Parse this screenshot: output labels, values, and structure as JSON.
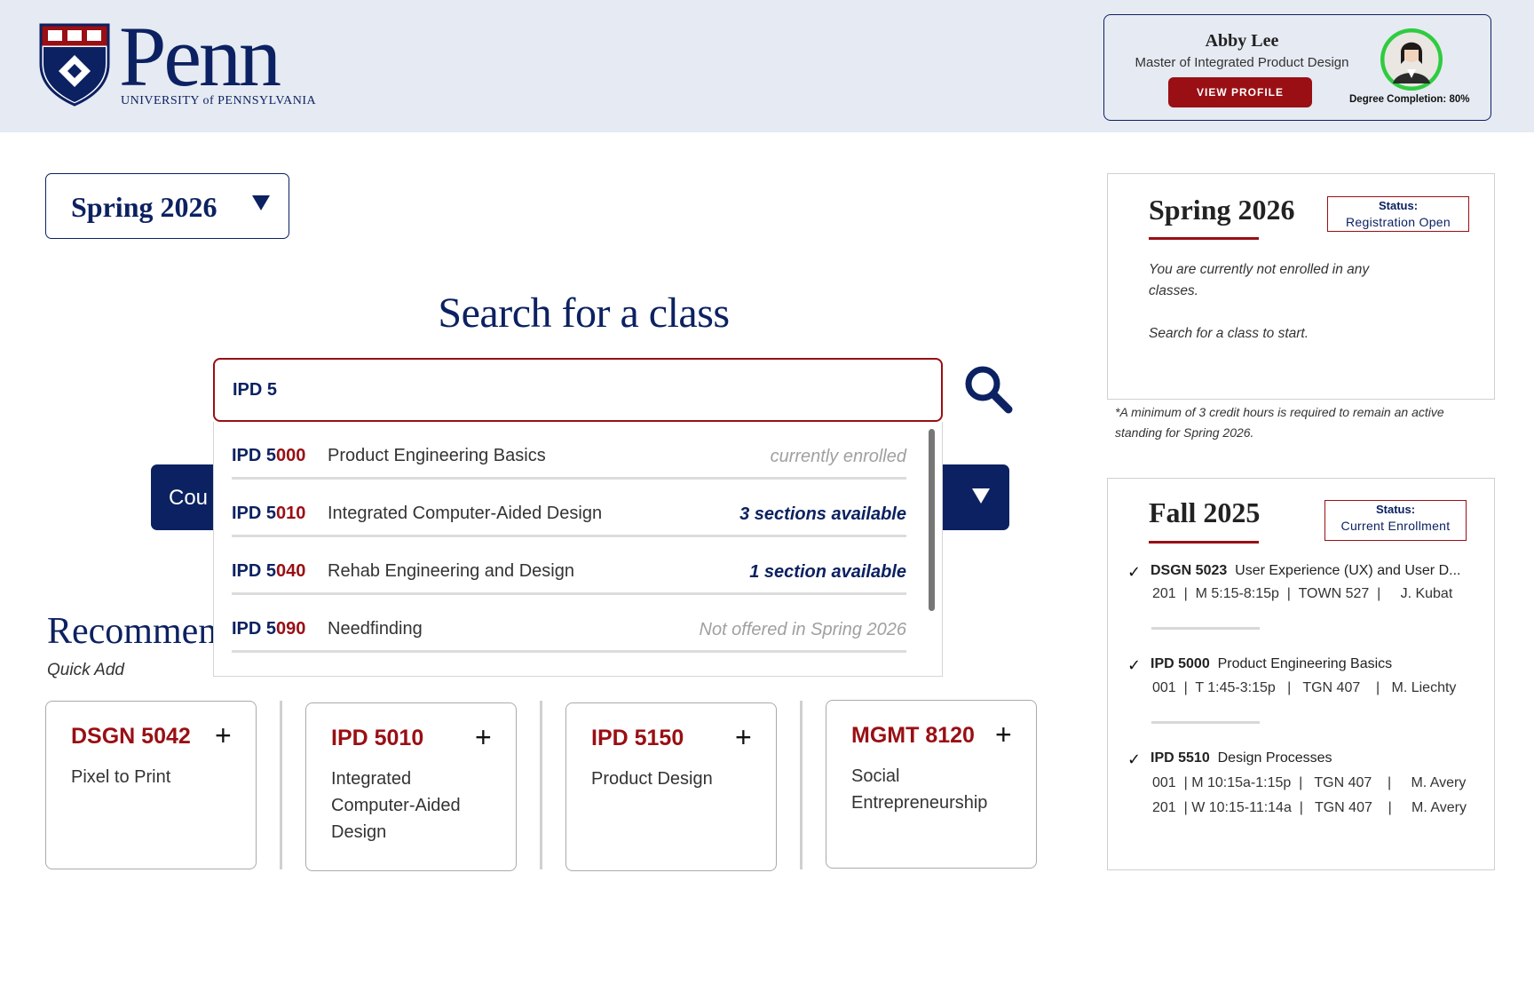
{
  "header": {
    "logo_wordmark": "Penn",
    "logo_subtitle": "UNIVERSITY of PENNSYLVANIA",
    "profile": {
      "name": "Abby Lee",
      "degree": "Master of Integrated Product Design",
      "button": "VIEW PROFILE",
      "completion_label": "Degree Completion: 80%",
      "completion": 0.8
    }
  },
  "term_select": {
    "value": "Spring 2026"
  },
  "search": {
    "title": "Search for a class",
    "query": "IPD 5",
    "results": [
      {
        "match": "IPD 5",
        "rest": "000",
        "name": "Product Engineering Basics",
        "status": "currently enrolled",
        "style": "grey"
      },
      {
        "match": "IPD 5",
        "rest": "010",
        "name": "Integrated Computer-Aided Design",
        "status": "3 sections available",
        "style": "blue"
      },
      {
        "match": "IPD 5",
        "rest": "040",
        "name": "Rehab Engineering and Design",
        "status": "1 section available",
        "style": "blue"
      },
      {
        "match": "IPD 5",
        "rest": "090",
        "name": "Needfinding",
        "status": "Not offered in Spring 2026",
        "style": "grey"
      }
    ]
  },
  "course_bar": {
    "label": "Cou"
  },
  "recommended": {
    "title": "Recommen",
    "subtitle": "Quick Add",
    "cards": [
      {
        "code": "DSGN 5042",
        "name": "Pixel to Print"
      },
      {
        "code": "IPD 5010",
        "name": "Integrated Computer-Aided Design"
      },
      {
        "code": "IPD 5150",
        "name": "Product Design"
      },
      {
        "code": "MGMT 8120",
        "name": "Social Entrepreneurship"
      }
    ],
    "plus": "+"
  },
  "spring_panel": {
    "title": "Spring 2026",
    "status_label": "Status:",
    "status_value": "Registration Open",
    "msg1": "You are currently not enrolled in any classes.",
    "msg2": "Search for a class to start."
  },
  "credit_note": "*A minimum of 3 credit hours is required to remain an active standing for Spring 2026.",
  "fall_panel": {
    "title": "Fall 2025",
    "status_label": "Status:",
    "status_value": "Current Enrollment",
    "courses": [
      {
        "code": "DSGN 5023",
        "name": "User Experience (UX) and User D...",
        "sections": [
          "201  |  M 5:15-8:15p  |  TOWN 527  |     J. Kubat"
        ]
      },
      {
        "code": "IPD 5000",
        "name": "Product Engineering Basics",
        "sections": [
          "001  |  T 1:45-3:15p   |   TGN 407    |   M. Liechty"
        ]
      },
      {
        "code": "IPD 5510",
        "name": "Design Processes",
        "sections": [
          "001  | M 10:15a-1:15p  |   TGN 407    |     M. Avery",
          "201  | W 10:15-11:14a  |   TGN 407    |     M. Avery"
        ]
      }
    ],
    "check": "✓"
  },
  "colors": {
    "navy": "#0c2161",
    "red": "#990f14",
    "header_bg": "#e6eaf2",
    "progress": "#2ecc40"
  }
}
